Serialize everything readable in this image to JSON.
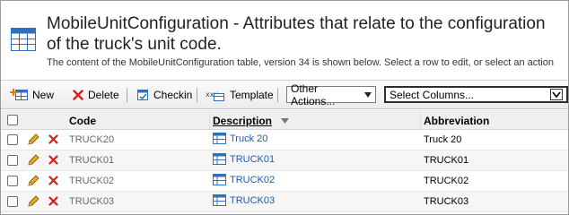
{
  "header": {
    "title": "MobileUnitConfiguration - Attributes that relate to the configuration of the truck's unit code.",
    "subtitle": "The content of the MobileUnitConfiguration table, version 34 is shown below. Select a row to edit, or select an action"
  },
  "toolbar": {
    "new_label": "New",
    "delete_label": "Delete",
    "checkin_label": "Checkin",
    "template_label": "Template",
    "other_actions_value": "Other Actions...",
    "select_columns_value": "Select Columns..."
  },
  "grid": {
    "columns": {
      "code": "Code",
      "description": "Description",
      "abbreviation": "Abbreviation"
    },
    "sort_column": "Description",
    "rows": [
      {
        "code": "TRUCK20",
        "description": "Truck 20",
        "abbreviation": "Truck 20"
      },
      {
        "code": "TRUCK01",
        "description": "TRUCK01",
        "abbreviation": "TRUCK01"
      },
      {
        "code": "TRUCK02",
        "description": "TRUCK02",
        "abbreviation": "TRUCK02"
      },
      {
        "code": "TRUCK03",
        "description": "TRUCK03",
        "abbreviation": "TRUCK03"
      }
    ]
  },
  "icons": {
    "header": "table-icon",
    "new": "new-row-icon",
    "delete": "delete-x-icon",
    "checkin": "checkin-icon",
    "template": "template-icon",
    "edit": "pencil-icon",
    "row_link": "table-link-icon"
  },
  "colors": {
    "link": "#1a5db3",
    "delete_red": "#d42020",
    "toolbar_bg": "#efefef"
  }
}
